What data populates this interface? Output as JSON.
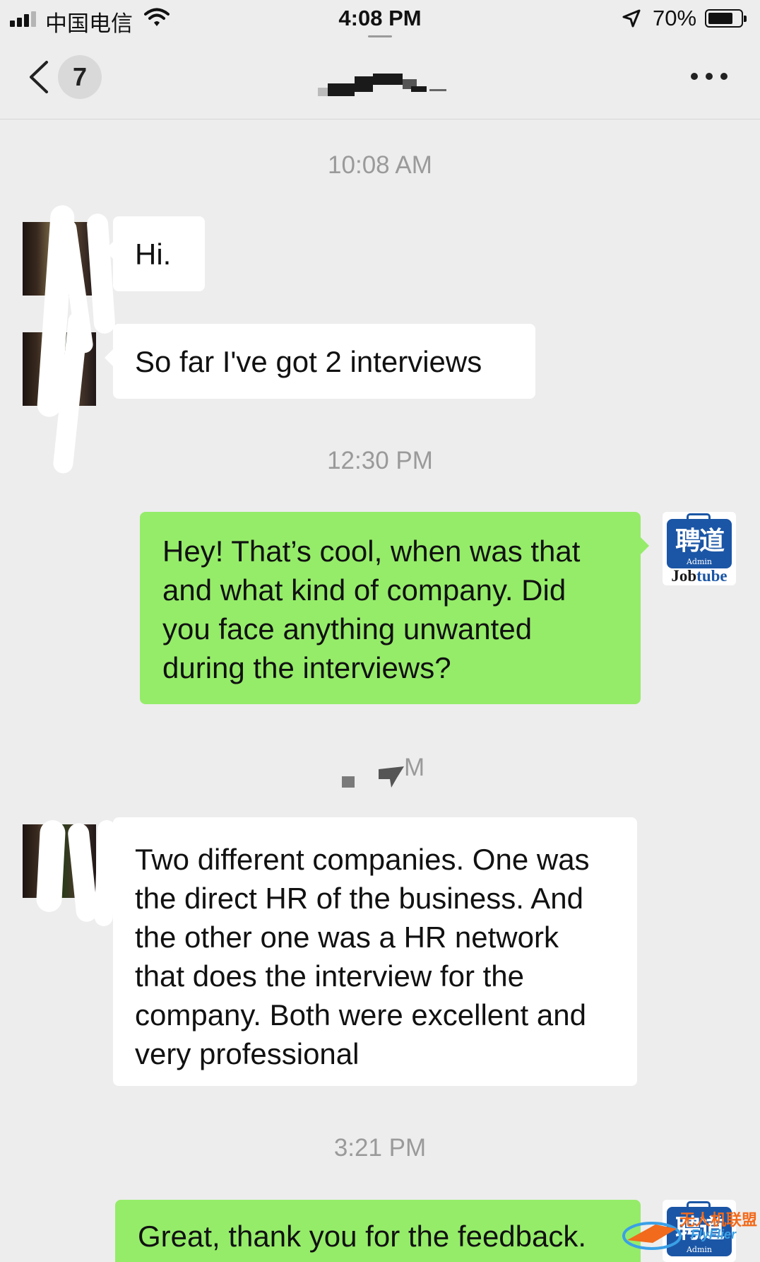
{
  "status_bar": {
    "carrier": "中国电信",
    "time": "4:08 PM",
    "battery_percent": "70%",
    "signal_bars_active": 3,
    "battery_level": 0.7
  },
  "nav": {
    "unread_count": "7",
    "back_icon": "chevron-left-icon",
    "more_icon": "more-dots-icon"
  },
  "messages": {
    "ts1": "10:08 AM",
    "m1": "Hi.",
    "m2": "So far I've got 2 interviews",
    "ts2": "12:30 PM",
    "m3": "Hey! That’s cool, when was that and what kind of company. Did you face anything unwanted during the interviews?",
    "ts3_partial": "M",
    "m4": "Two different companies. One was the direct HR of the business. And the other one was a HR network that does the interview for the company. Both were excellent and very professional",
    "ts4": "3:21 PM",
    "m5": "Great, thank you for the feedback."
  },
  "jobtube_avatar": {
    "cn": "聘道",
    "admin": "Admin",
    "en_a": "Job",
    "en_b": "tube"
  },
  "watermark": {
    "cn": "无人机联盟",
    "en": "FlyFlier"
  },
  "colors": {
    "background": "#ededed",
    "outgoing_bubble": "#95ec69",
    "incoming_bubble": "#ffffff",
    "timestamp_text": "#9a9a9a",
    "brand_blue": "#1b56a6"
  }
}
